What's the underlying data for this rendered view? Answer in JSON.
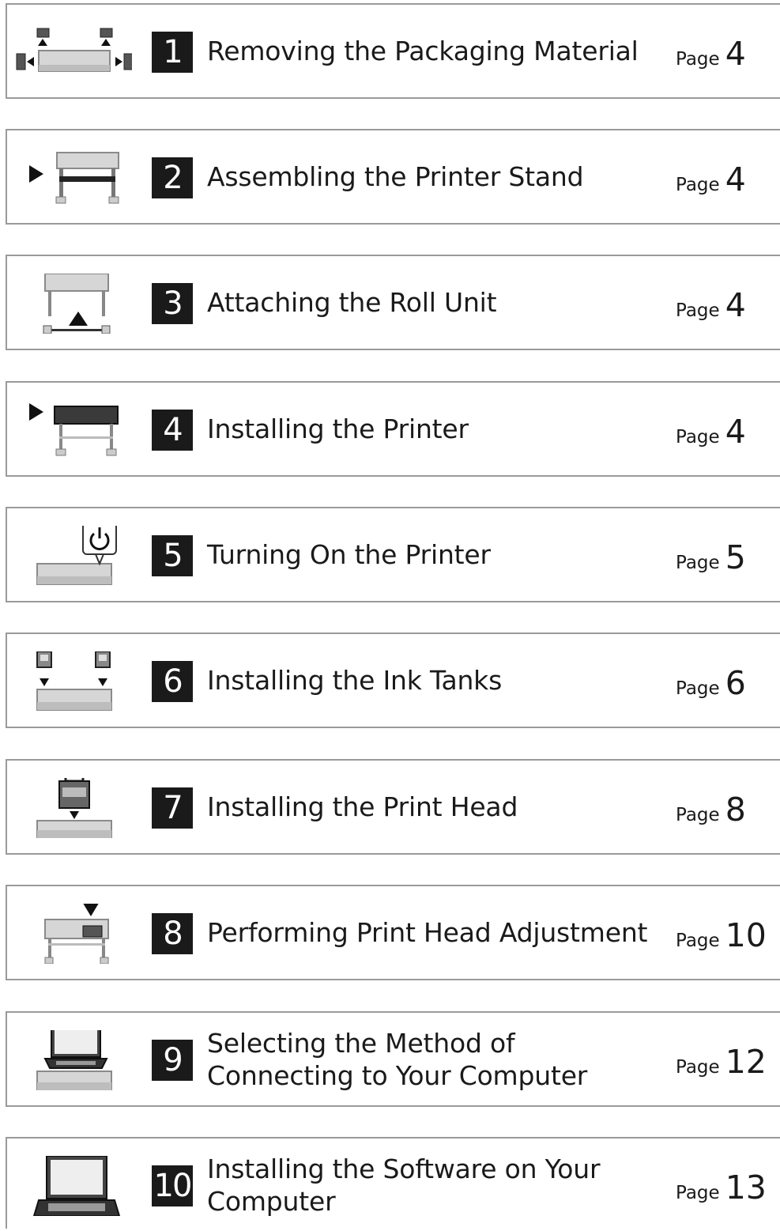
{
  "steps": [
    {
      "number": "1",
      "title": "Removing the Packaging Material",
      "page_label": "Page",
      "page": "4",
      "icon": "unpacking-icon"
    },
    {
      "number": "2",
      "title": "Assembling the Printer Stand",
      "page_label": "Page",
      "page": "4",
      "icon": "printer-stand-icon"
    },
    {
      "number": "3",
      "title": "Attaching the Roll Unit",
      "page_label": "Page",
      "page": "4",
      "icon": "roll-unit-icon"
    },
    {
      "number": "4",
      "title": "Installing the Printer",
      "page_label": "Page",
      "page": "4",
      "icon": "printer-install-icon"
    },
    {
      "number": "5",
      "title": "Turning On the Printer",
      "page_label": "Page",
      "page": "5",
      "icon": "power-icon"
    },
    {
      "number": "6",
      "title": "Installing the Ink Tanks",
      "page_label": "Page",
      "page": "6",
      "icon": "ink-tank-icon"
    },
    {
      "number": "7",
      "title": "Installing the Print Head",
      "page_label": "Page",
      "page": "8",
      "icon": "print-head-icon"
    },
    {
      "number": "8",
      "title": "Performing Print Head Adjustment",
      "page_label": "Page",
      "page": "10",
      "icon": "head-adjust-icon"
    },
    {
      "number": "9",
      "title": "Selecting the Method of Connecting to Your Computer",
      "page_label": "Page",
      "page": "12",
      "icon": "laptop-printer-icon"
    },
    {
      "number": "10",
      "title": "Installing the Software on Your Computer",
      "page_label": "Page",
      "page": "13",
      "icon": "laptop-icon"
    }
  ]
}
